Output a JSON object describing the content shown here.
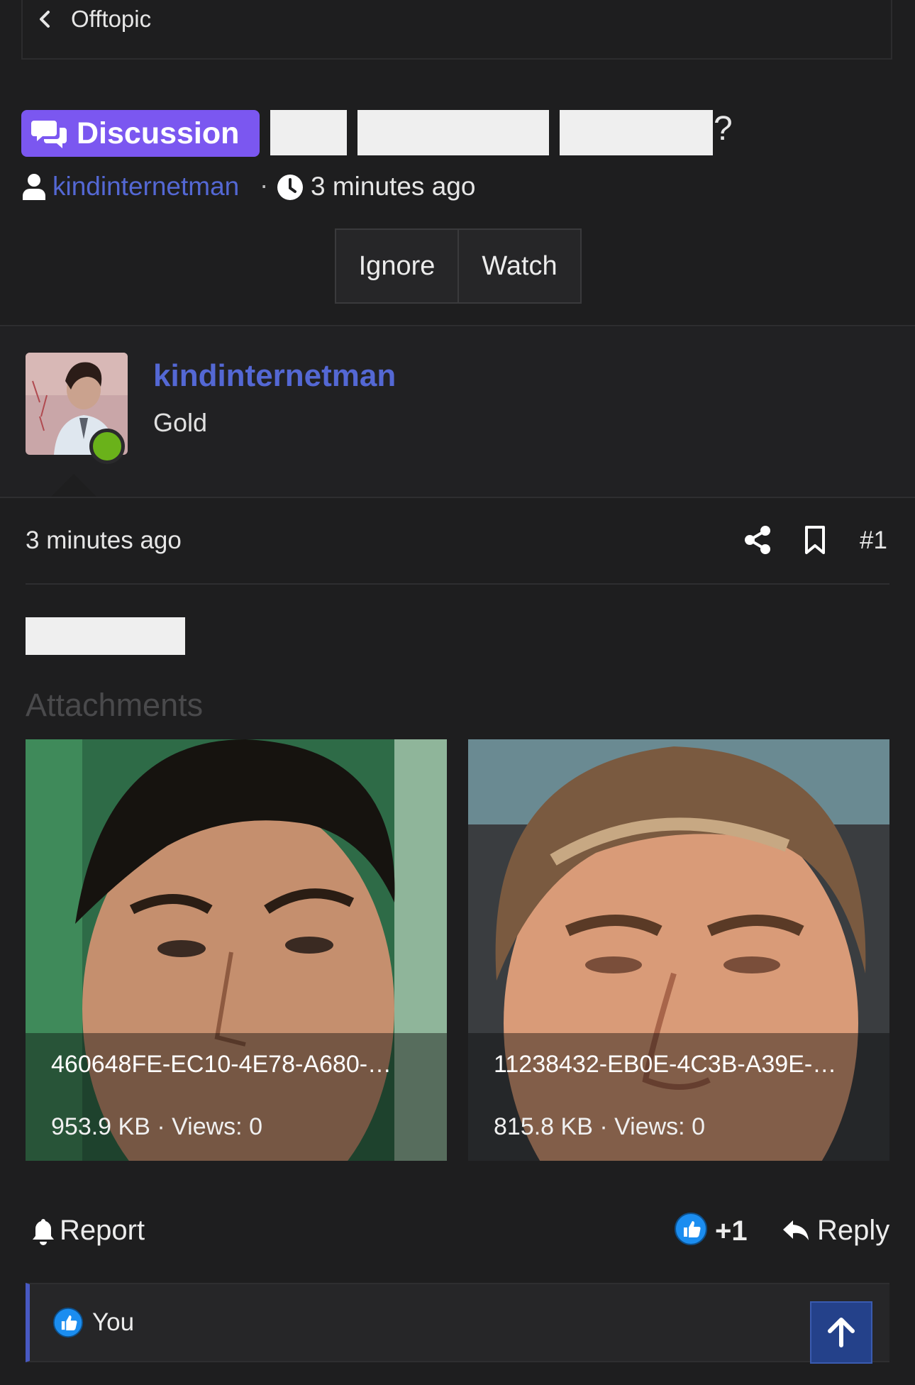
{
  "breadcrumb": {
    "label": "Offtopic"
  },
  "thread": {
    "prefix": "Discussion",
    "title_suffix": "?",
    "author": "kindinternetman",
    "separator": "·",
    "time": "3 minutes ago",
    "actions": {
      "ignore": "Ignore",
      "watch": "Watch"
    }
  },
  "post": {
    "author": "kindinternetman",
    "author_title": "Gold",
    "time": "3 minutes ago",
    "number": "#1",
    "attachments_heading": "Attachments",
    "attachments": [
      {
        "name": "460648FE-EC10-4E78-A680-…",
        "meta": "953.9 KB · Views: 0"
      },
      {
        "name": "11238432-EB0E-4C3B-A39E-…",
        "meta": "815.8 KB · Views: 0"
      }
    ],
    "report_label": "Report",
    "reaction_count": "+1",
    "reply_label": "Reply",
    "likes_by": "You"
  },
  "colors": {
    "accent": "#7b57f0",
    "link": "#5468d4",
    "online": "#6ab21a",
    "background": "#1e1e1f"
  }
}
